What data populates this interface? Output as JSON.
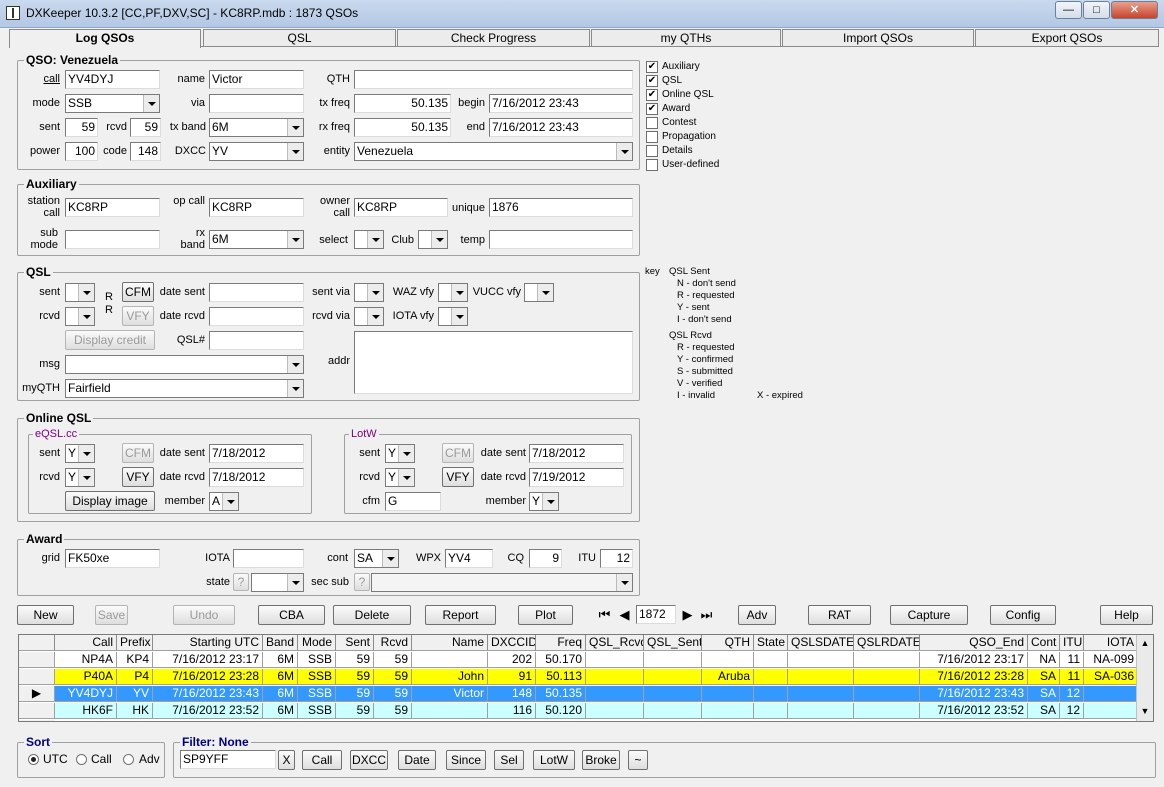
{
  "window": {
    "title": "DXKeeper 10.3.2 [CC,PF,DXV,SC] - KC8RP.mdb : 1873 QSOs",
    "min": "—",
    "max": "□",
    "close": "✕"
  },
  "tabs": [
    "Log QSOs",
    "QSL",
    "Check Progress",
    "my QTHs",
    "Import QSOs",
    "Export QSOs"
  ],
  "qso": {
    "title": "QSO: Venezuela",
    "call_label": "call",
    "call": "YV4DYJ",
    "name_label": "name",
    "name": "Victor",
    "qth_label": "QTH",
    "qth": "",
    "mode_label": "mode",
    "mode": "SSB",
    "via_label": "via",
    "via": "",
    "txfreq_label": "tx freq",
    "txfreq": "50.135",
    "begin_label": "begin",
    "begin": "7/16/2012   23:43",
    "sent_label": "sent",
    "sent": "59",
    "rcvd_label": "rcvd",
    "rcvd": "59",
    "txband_label": "tx band",
    "txband": "6M",
    "rxfreq_label": "rx freq",
    "rxfreq": "50.135",
    "end_label": "end",
    "end": "7/16/2012   23:43",
    "power_label": "power",
    "power": "100",
    "code_label": "code",
    "code": "148",
    "dxcc_label": "DXCC",
    "dxcc": "YV",
    "entity_label": "entity",
    "entity": "Venezuela"
  },
  "checks": [
    {
      "label": "Auxiliary",
      "on": true
    },
    {
      "label": "QSL",
      "on": true
    },
    {
      "label": "Online QSL",
      "on": true
    },
    {
      "label": "Award",
      "on": true
    },
    {
      "label": "Contest",
      "on": false
    },
    {
      "label": "Propagation",
      "on": false
    },
    {
      "label": "Details",
      "on": false
    },
    {
      "label": "User-defined",
      "on": false
    }
  ],
  "aux": {
    "title": "Auxiliary",
    "station_label": "station call",
    "station": "KC8RP",
    "op_label": "op call",
    "op": "KC8RP",
    "owner_label": "owner call",
    "owner": "KC8RP",
    "unique_label": "unique",
    "unique": "1876",
    "submode_label": "sub mode",
    "submode": "",
    "rxband_label": "rx band",
    "rxband": "6M",
    "select_label": "select",
    "club_label": "Club",
    "temp_label": "temp",
    "temp": ""
  },
  "qsl": {
    "title": "QSL",
    "sent_label": "sent",
    "rr": "R R",
    "cfm": "CFM",
    "datesent_label": "date sent",
    "sentvia_label": "sent via",
    "waz_label": "WAZ vfy",
    "vucc_label": "VUCC vfy",
    "rcvd_label": "rcvd",
    "vfy": "VFY",
    "datercvd_label": "date rcvd",
    "rcvdvia_label": "rcvd via",
    "iota_label": "IOTA vfy",
    "display_credit": "Display credit",
    "qslnum_label": "QSL#",
    "msg_label": "msg",
    "addr_label": "addr",
    "myqth_label": "myQTH",
    "myqth": "Fairfield"
  },
  "legend": {
    "key": "key",
    "sent_title": "QSL Sent",
    "sent_items": [
      "N  - don't send",
      "R  - requested",
      "Y  - sent",
      "I   - don't send"
    ],
    "rcvd_title": "QSL Rcvd",
    "rcvd_items": [
      "R  - requested",
      "Y  - confirmed",
      "S  - submitted",
      "V  - verified",
      "I   - invalid"
    ],
    "expired": "X  - expired"
  },
  "online": {
    "title": "Online QSL",
    "eqsl": {
      "title": "eQSL.cc",
      "sent_label": "sent",
      "sent": "Y",
      "cfm": "CFM",
      "datesent_label": "date sent",
      "datesent": "7/18/2012",
      "rcvd_label": "rcvd",
      "rcvd": "Y",
      "vfy": "VFY",
      "datercvd_label": "date rcvd",
      "datercvd": "7/18/2012",
      "display_image": "Display image",
      "member_label": "member",
      "member": "A"
    },
    "lotw": {
      "title": "LotW",
      "sent_label": "sent",
      "sent": "Y",
      "cfm": "CFM",
      "datesent_label": "date sent",
      "datesent": "7/18/2012",
      "rcvd_label": "rcvd",
      "rcvd": "Y",
      "vfy": "VFY",
      "datercvd_label": "date rcvd",
      "datercvd": "7/19/2012",
      "cfm_label": "cfm",
      "cfm_val": "G",
      "member_label": "member",
      "member": "Y"
    }
  },
  "award": {
    "title": "Award",
    "grid_label": "grid",
    "grid": "FK50xe",
    "iota_label": "IOTA",
    "iota": "",
    "cont_label": "cont",
    "cont": "SA",
    "wpx_label": "WPX",
    "wpx": "YV4",
    "cq_label": "CQ",
    "cq": "9",
    "itu_label": "ITU",
    "itu": "12",
    "state_label": "state",
    "state_q": "?",
    "secsub_label": "sec sub",
    "secsub_q": "?"
  },
  "buttons": {
    "new": "New",
    "save": "Save",
    "undo": "Undo",
    "cba": "CBA",
    "delete": "Delete",
    "report": "Report",
    "plot": "Plot",
    "record": "1872",
    "adv": "Adv",
    "rat": "RAT",
    "capture": "Capture",
    "config": "Config",
    "help": "Help"
  },
  "grid": {
    "columns": [
      "",
      "Call",
      "Prefix",
      "Starting UTC",
      "Band",
      "Mode",
      "Sent",
      "Rcvd",
      "Name",
      "DXCCID",
      "Freq",
      "QSL_Rcvd",
      "QSL_Sent",
      "QTH",
      "State",
      "QSLSDATE",
      "QSLRDATE",
      "QSO_End",
      "Cont",
      "ITU",
      "IOTA"
    ],
    "rows": [
      {
        "marker": "",
        "cells": [
          "NP4A",
          "KP4",
          "7/16/2012   23:17",
          "6M",
          "SSB",
          "59",
          "59",
          "",
          "202",
          "50.170",
          "",
          "",
          "",
          "",
          "",
          "",
          "7/16/2012   23:17",
          "NA",
          "11",
          "NA-099"
        ],
        "bg": "#ffffff",
        "fg": "#000000"
      },
      {
        "marker": "",
        "cells": [
          "P40A",
          "P4",
          "7/16/2012   23:28",
          "6M",
          "SSB",
          "59",
          "59",
          "John",
          "91",
          "50.113",
          "",
          "",
          "Aruba",
          "",
          "",
          "",
          "7/16/2012   23:28",
          "SA",
          "11",
          "SA-036"
        ],
        "bg": "#ffff00",
        "fg": "#000000"
      },
      {
        "marker": "▶",
        "cells": [
          "YV4DYJ",
          "YV",
          "7/16/2012   23:43",
          "6M",
          "SSB",
          "59",
          "59",
          "Victor",
          "148",
          "50.135",
          "",
          "",
          "",
          "",
          "",
          "",
          "7/16/2012   23:43",
          "SA",
          "12",
          ""
        ],
        "bg": "#3399ff",
        "fg": "#ffffff"
      },
      {
        "marker": "",
        "cells": [
          "HK6F",
          "HK",
          "7/16/2012   23:52",
          "6M",
          "SSB",
          "59",
          "59",
          "",
          "116",
          "50.120",
          "",
          "",
          "",
          "",
          "",
          "",
          "7/16/2012   23:52",
          "SA",
          "12",
          ""
        ],
        "bg": "#ccffff",
        "fg": "#000000"
      }
    ]
  },
  "sort": {
    "title": "Sort",
    "options": [
      "UTC",
      "Call",
      "Adv"
    ],
    "selected": "UTC"
  },
  "filter": {
    "title": "Filter: None",
    "value": "SP9YFF",
    "clear": "X",
    "buttons": [
      "Call",
      "DXCC",
      "Date",
      "Since",
      "Sel",
      "LotW",
      "Broke",
      "~"
    ]
  },
  "colors": {
    "title_text": "#000080",
    "purple": "#800080",
    "selected_row": "#3399ff",
    "yellow_row": "#ffff00",
    "cyan_row": "#ccffff"
  }
}
